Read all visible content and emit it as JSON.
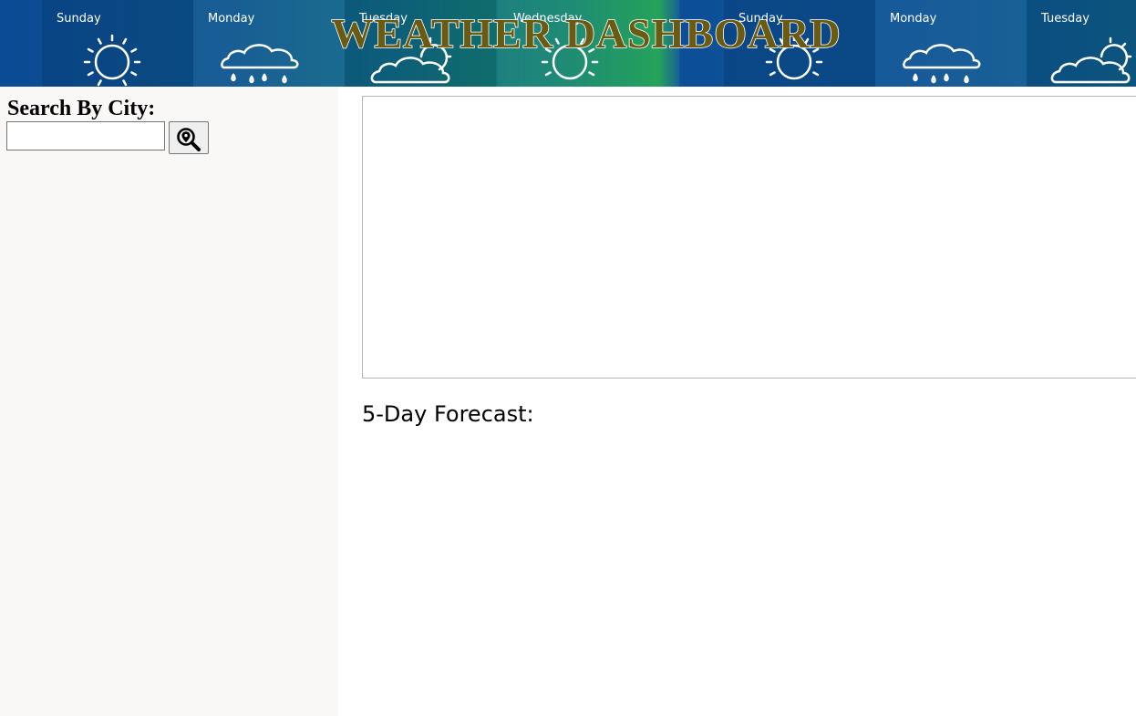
{
  "header": {
    "title": "WEATHER DASHBOARD",
    "banner_days": [
      {
        "day": "Sunday",
        "icon": "sun-icon"
      },
      {
        "day": "Monday",
        "icon": "rain-cloud-icon"
      },
      {
        "day": "Tuesday",
        "icon": "partly-cloudy-icon"
      },
      {
        "day": "Wednesday",
        "icon": "sun-icon"
      },
      {
        "day": "Sunday",
        "icon": "sun-icon"
      },
      {
        "day": "Monday",
        "icon": "rain-cloud-icon"
      },
      {
        "day": "Tuesday",
        "icon": "partly-cloudy-icon"
      }
    ]
  },
  "sidebar": {
    "search_label": "Search By City:",
    "search_input_value": "",
    "search_button_icon": "location-search-icon"
  },
  "main": {
    "forecast_heading": "5-Day Forecast:"
  },
  "colors": {
    "banner_blue": "#0b4a94",
    "banner_green": "#1a9e52",
    "title_fill": "#6b5a12",
    "sidebar_bg": "#faf7f7"
  }
}
